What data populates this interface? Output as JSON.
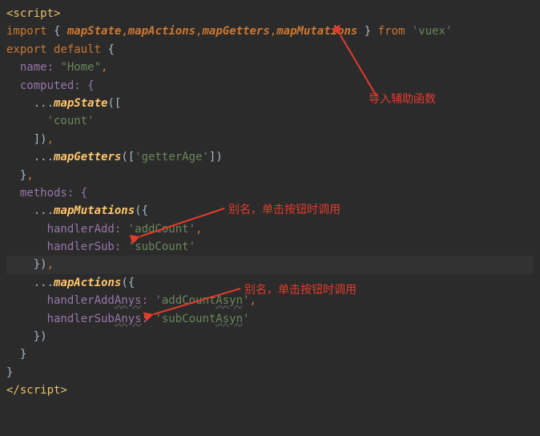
{
  "code": {
    "l1_open": "<script>",
    "l2_import": "import",
    "l2_brace_open": " { ",
    "l2_fn1": "mapState",
    "l2_c1": ",",
    "l2_fn2": "mapActions",
    "l2_c2": ",",
    "l2_fn3": "mapGetters",
    "l2_c3": ",",
    "l2_fn4": "mapMutations",
    "l2_brace_close": " } ",
    "l2_from": "from ",
    "l2_vuex": "'vuex'",
    "l3_export": "export ",
    "l3_default": "default ",
    "l3_brace": "{",
    "l4_name": "  name: ",
    "l4_val": "\"Home\"",
    "l4_c": ",",
    "l5_computed": "  computed: {",
    "l6_spread": "    ...",
    "l6_fn": "mapState",
    "l6_open": "([",
    "l7_count": "      'count'",
    "l8_close": "    ])",
    "l8_c": ",",
    "l9_spread": "    ...",
    "l9_fn": "mapGetters",
    "l9_open": "([",
    "l9_arg": "'getterAge'",
    "l9_close": "])",
    "l10_close": "  }",
    "l10_c": ",",
    "l11_methods": "  methods: {",
    "l12_spread": "    ...",
    "l12_fn": "mapMutations",
    "l12_open": "({",
    "l13_key": "      handlerAdd: ",
    "l13_val": "'addCount'",
    "l13_c": ",",
    "l14_key": "      handlerSub: ",
    "l14_val": "'subCount'",
    "l15_close": "    })",
    "l15_c": ",",
    "l16_spread": "    ...",
    "l16_fn": "mapActions",
    "l16_open": "({",
    "l17_key1": "      handlerAdd",
    "l17_key2": "Anys",
    "l17_colon": ": ",
    "l17_val1": "'addCount",
    "l17_val2": "Asyn",
    "l17_val3": "'",
    "l17_c": ",",
    "l18_key1": "      handlerSub",
    "l18_key2": "Anys",
    "l18_colon": ": ",
    "l18_val1": "'subCount",
    "l18_val2": "Asyn",
    "l18_val3": "'",
    "l19_close": "    })",
    "l20_close": "  }",
    "l21_close": "}",
    "l22_close_script": "</script>"
  },
  "annotations": {
    "a1": "导入辅助函数",
    "a2": "别名，单击按钮时调用",
    "a3": "别名，单击按钮时调用"
  }
}
